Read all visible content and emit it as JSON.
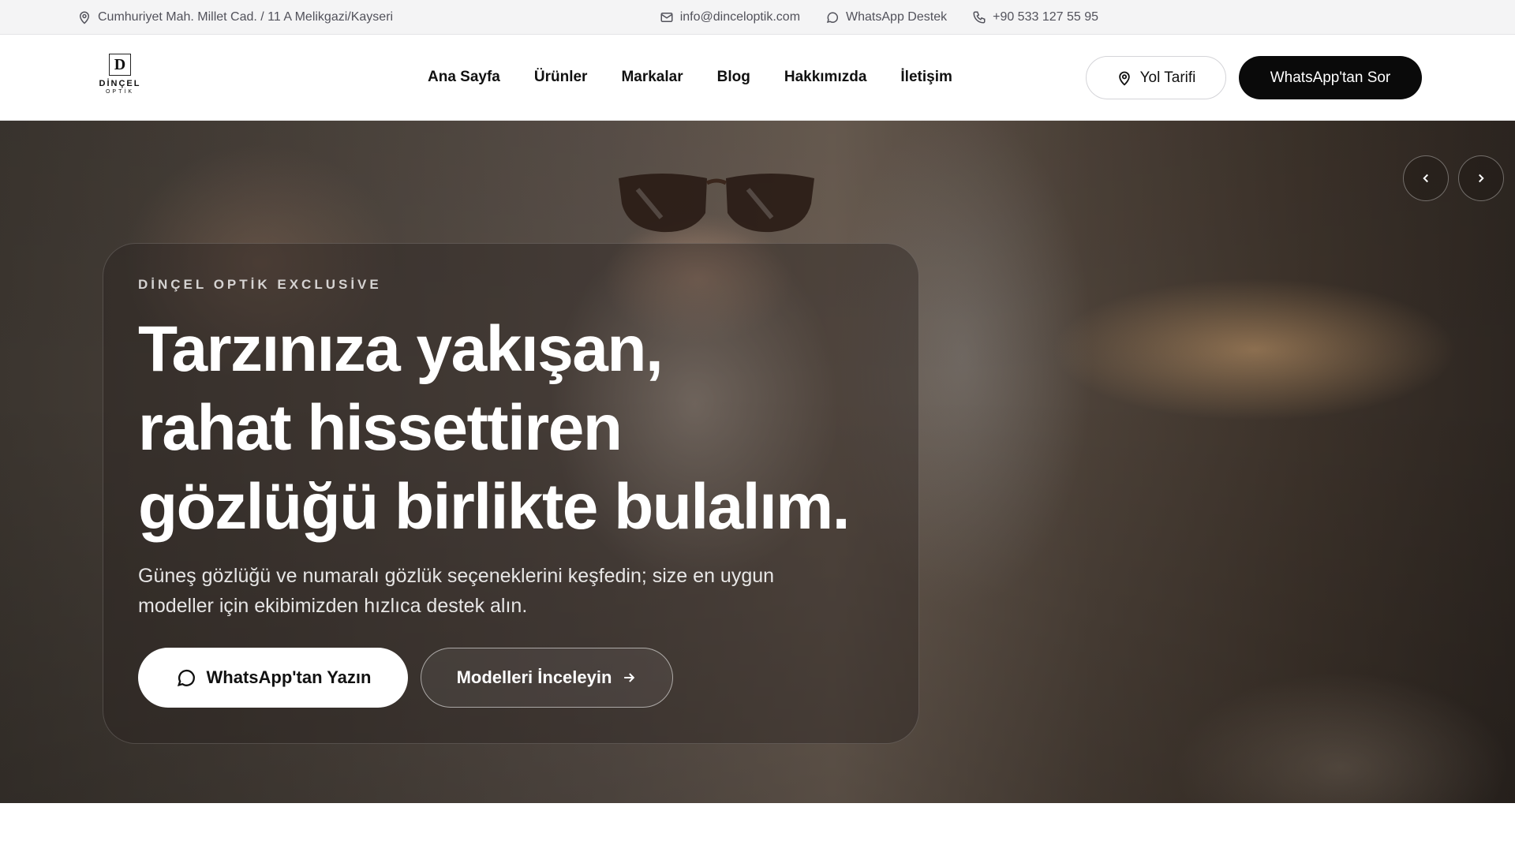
{
  "topbar": {
    "address": "Cumhuriyet Mah. Millet Cad. / 11 A Melikgazi/Kayseri",
    "address_icon": "map-pin-icon",
    "email": "info@dinceloptik.com",
    "email_icon": "mail-icon",
    "whatsapp": "WhatsApp Destek",
    "whatsapp_icon": "chat-bubble-icon",
    "phone": "+90 533 127 55 95",
    "phone_icon": "phone-icon"
  },
  "brand": {
    "logo_mark": "D",
    "logo_line1": "DİNÇEL",
    "logo_line2": "OPTİK"
  },
  "nav": {
    "items": [
      {
        "label": "Ana Sayfa"
      },
      {
        "label": "Ürünler"
      },
      {
        "label": "Markalar"
      },
      {
        "label": "Blog"
      },
      {
        "label": "Hakkımızda"
      },
      {
        "label": "İletişim"
      }
    ],
    "route_button": "Yol Tarifi",
    "route_icon": "map-pin-icon",
    "whatsapp_button": "WhatsApp'tan Sor"
  },
  "hero": {
    "eyebrow": "DİNÇEL OPTİK EXCLUSİVE",
    "headline": {
      "line1": "Tarzınıza yakışan,",
      "line2": "rahat hissettiren",
      "line3": "gözlüğü birlikte bulalım."
    },
    "lead": "Güneş gözlüğü ve numaralı gözlük seçeneklerini keşfedin; size en uygun modeller için ekibimizden hızlıca destek alın.",
    "cta_primary": "WhatsApp'tan Yazın",
    "cta_primary_icon": "chat-bubble-icon",
    "cta_secondary": "Modelleri İnceleyin",
    "cta_secondary_icon": "arrow-right-icon",
    "slider_prev_icon": "chevron-left-icon",
    "slider_next_icon": "chevron-right-icon"
  },
  "colors": {
    "topbar_bg": "#f4f4f5",
    "header_button_dark": "#0a0a0a",
    "text_muted": "#52525b"
  }
}
